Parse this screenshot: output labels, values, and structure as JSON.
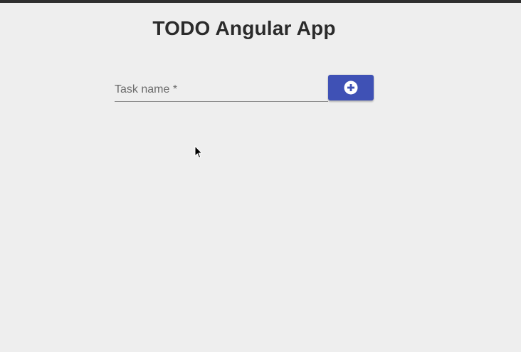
{
  "app": {
    "title": "TODO Angular App"
  },
  "task_form": {
    "input_label": "Task name *",
    "input_value": "",
    "add_button_icon": "plus-circle-icon"
  },
  "theme": {
    "primary": "#3f51b5",
    "background": "#eeeeee",
    "top_bar": "#2f2f2f"
  }
}
